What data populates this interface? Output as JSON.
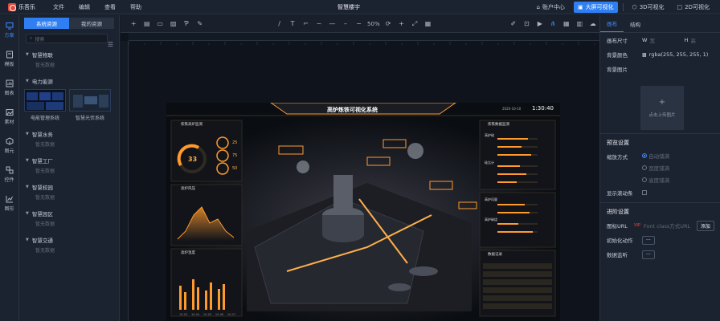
{
  "menu": {
    "brand": "乐吾乐",
    "items": [
      "文件",
      "编辑",
      "查看",
      "帮助"
    ],
    "title": "智慧楼宇"
  },
  "topright": {
    "account": "账户中心",
    "bigscreen": "大屏可视化",
    "v3d": "3D可视化",
    "v2d": "2D可视化"
  },
  "sidebar": {
    "items": [
      {
        "label": "方案"
      },
      {
        "label": "模板"
      },
      {
        "label": "图表"
      },
      {
        "label": "素材"
      },
      {
        "label": "图元"
      },
      {
        "label": "控件"
      },
      {
        "label": "图形"
      }
    ]
  },
  "resources": {
    "tabs": [
      "系统资源",
      "我的资源"
    ],
    "search_placeholder": "搜索",
    "empty": "暂无数据",
    "categories": [
      "智慧物联",
      "电力能源",
      "智慧水务",
      "智慧工厂",
      "智慧校园",
      "智慧园区",
      "智慧交通"
    ],
    "thumbs": [
      "电能管理系统",
      "智慧光伏系统"
    ]
  },
  "toolbar": {
    "zoom": "50%"
  },
  "stage": {
    "title": "高炉炼铁可视化系统",
    "date": "2020-10-10",
    "time": "1:30:40",
    "panels": [
      "炼铁高炉监测",
      "高炉风压",
      "高炉温度",
      "炼铁数据监测",
      "高炉硫",
      "硅比计",
      "高炉风量",
      "高炉碳烧",
      "数据记录"
    ],
    "gauge": "33",
    "stats": [
      "25",
      "75",
      "50"
    ],
    "chart_labels": [
      "10-03",
      "10-04",
      "10-05",
      "10-06",
      "10-07"
    ]
  },
  "properties": {
    "tabs": [
      "画布",
      "结构"
    ],
    "canvas_size": "画布尺寸",
    "w": "W",
    "w_ph": "宽",
    "h": "H",
    "h_ph": "高",
    "bg_color_label": "背景颜色",
    "bg_color": "rgba(255, 255, 255, 1)",
    "bg_image_label": "背景图片",
    "upload": "点击上传图片",
    "preview_section": "预览设置",
    "scale_label": "缩放方式",
    "scale_opts": [
      "自动铺满",
      "宽度铺满",
      "高度铺满"
    ],
    "scroll_label": "显示滚动条",
    "advanced_section": "进阶设置",
    "icon_url_label": "图标URL",
    "icon_url_ph": "Font class方式URL",
    "add": "添加",
    "init_label": "初始化动作",
    "monitor_label": "数据监听",
    "more": "···"
  }
}
